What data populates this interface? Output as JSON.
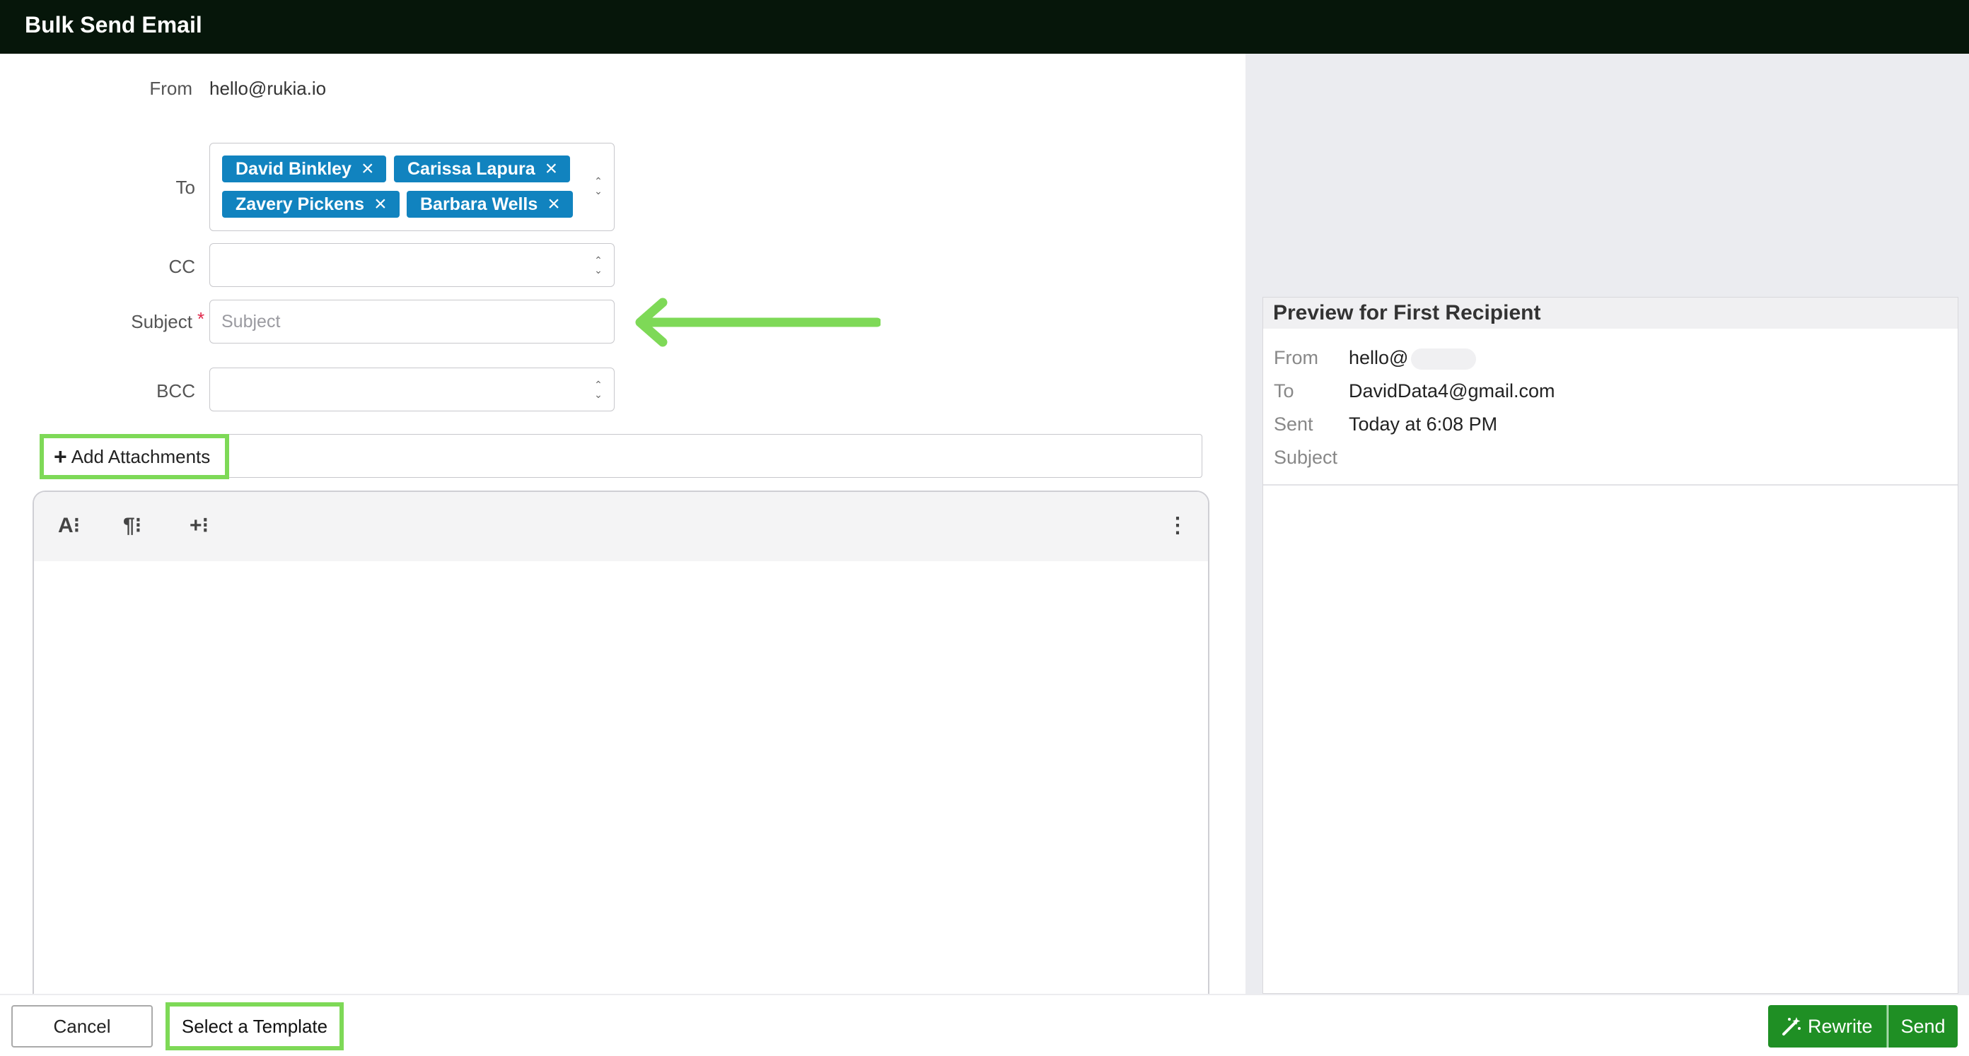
{
  "header": {
    "title": "Bulk Send Email"
  },
  "form": {
    "from_label": "From",
    "from_value": "hello@rukia.io",
    "to_label": "To",
    "to_recipients": [
      {
        "name": "David Binkley"
      },
      {
        "name": "Carissa Lapura"
      },
      {
        "name": "Zavery Pickens"
      },
      {
        "name": "Barbara Wells"
      }
    ],
    "cc_label": "CC",
    "subject_label": "Subject",
    "subject_required_mark": "*",
    "subject_placeholder": "Subject",
    "bcc_label": "BCC",
    "add_attachments_label": "Add Attachments"
  },
  "editor_toolbar": {
    "text_format": "A⁝",
    "paragraph_format": "¶⁝",
    "insert": "+⁝",
    "more": "⋮"
  },
  "preview": {
    "title": "Preview for First Recipient",
    "from_label": "From",
    "from_value": "hello@",
    "to_label": "To",
    "to_value": "DavidData4@gmail.com",
    "sent_label": "Sent",
    "sent_value": "Today at 6:08 PM",
    "subject_label": "Subject"
  },
  "footer": {
    "cancel_label": "Cancel",
    "template_label": "Select a Template",
    "rewrite_label": "Rewrite",
    "send_label": "Send"
  },
  "colors": {
    "header_bg": "#06160a",
    "tag_bg": "#1183bf",
    "highlight": "#7ed957",
    "primary_button": "#1f8f24",
    "right_panel_bg": "#ebecf0"
  },
  "icons": [
    "close-icon",
    "chevron-updown-icon",
    "plus-icon",
    "magic-wand-icon",
    "vertical-dots-icon"
  ]
}
